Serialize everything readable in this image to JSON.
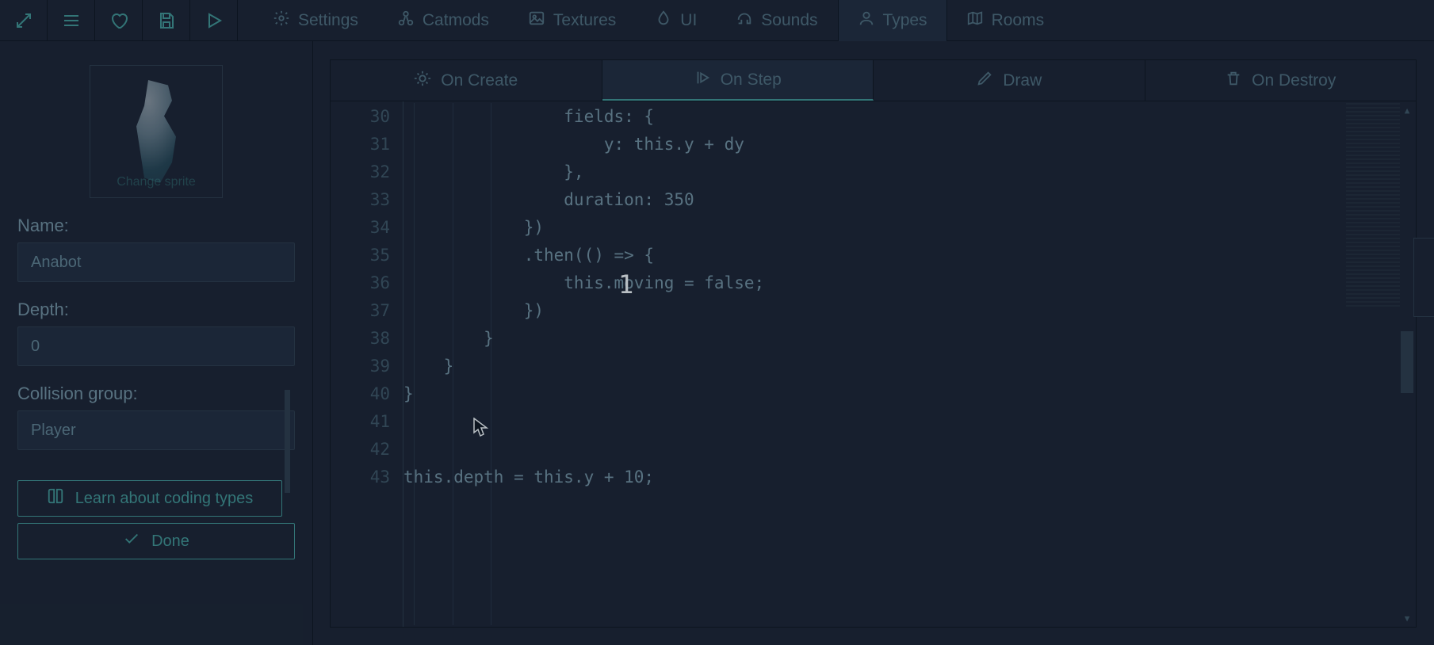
{
  "topbar": {
    "tabs": [
      {
        "id": "settings",
        "label": "Settings",
        "icon": "gear-icon"
      },
      {
        "id": "catmods",
        "label": "Catmods",
        "icon": "modules-icon"
      },
      {
        "id": "textures",
        "label": "Textures",
        "icon": "image-icon"
      },
      {
        "id": "ui",
        "label": "UI",
        "icon": "droplet-icon"
      },
      {
        "id": "sounds",
        "label": "Sounds",
        "icon": "headphones-icon"
      },
      {
        "id": "types",
        "label": "Types",
        "icon": "person-icon"
      },
      {
        "id": "rooms",
        "label": "Rooms",
        "icon": "map-icon"
      }
    ],
    "active": "types"
  },
  "sidebar": {
    "change_sprite_label": "Change sprite",
    "name_label": "Name:",
    "name_value": "Anabot",
    "depth_label": "Depth:",
    "depth_value": "0",
    "collision_label": "Collision group:",
    "collision_value": "Player",
    "learn_label": "Learn about coding types",
    "done_label": "Done"
  },
  "codeTabs": {
    "items": [
      {
        "id": "oncreate",
        "label": "On Create",
        "icon": "sun-icon"
      },
      {
        "id": "onstep",
        "label": "On Step",
        "icon": "step-icon"
      },
      {
        "id": "draw",
        "label": "Draw",
        "icon": "pencil-icon"
      },
      {
        "id": "ondestroy",
        "label": "On Destroy",
        "icon": "trash-icon"
      }
    ],
    "active": "onstep"
  },
  "code": {
    "first_line": 30,
    "lines": [
      "                fields: {",
      "                    y: this.y + dy",
      "                },",
      "                duration: 350",
      "            })",
      "            .then(() => {",
      "                this.moving = false;",
      "            })",
      "        }",
      "    }",
      "}",
      "",
      "",
      "this.depth = this.y + 10;"
    ]
  },
  "overlay_char": "1"
}
